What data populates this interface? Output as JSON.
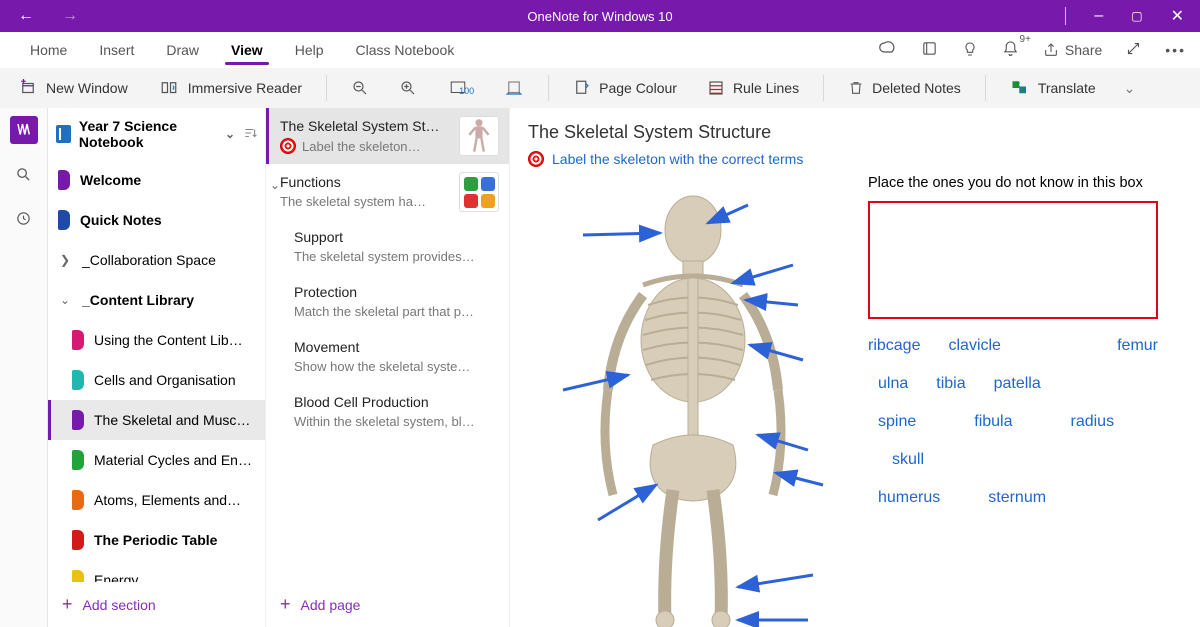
{
  "titlebar": {
    "title": "OneNote for Windows 10"
  },
  "tabs": {
    "items": [
      "Home",
      "Insert",
      "Draw",
      "View",
      "Help",
      "Class Notebook"
    ],
    "active_index": 3,
    "share_label": "Share",
    "notification_badge": "9+"
  },
  "toolbar": {
    "new_window": "New Window",
    "immersive_reader": "Immersive Reader",
    "page_colour": "Page Colour",
    "rule_lines": "Rule Lines",
    "deleted_notes": "Deleted Notes",
    "translate": "Translate"
  },
  "notebook": {
    "name": "Year 7 Science Notebook",
    "add_section": "Add section",
    "sections": [
      {
        "label": "Welcome",
        "color": "#7719AA",
        "type": "section"
      },
      {
        "label": "Quick Notes",
        "color": "#1f4aa8",
        "type": "section"
      },
      {
        "label": "_Collaboration Space",
        "type": "group",
        "expanded": false
      },
      {
        "label": "_Content Library",
        "type": "group",
        "expanded": true
      },
      {
        "label": "Using the Content Lib…",
        "color": "#d61a72",
        "type": "section",
        "parent": "cl"
      },
      {
        "label": "Cells and Organisation",
        "color": "#1fb7b0",
        "type": "section",
        "parent": "cl"
      },
      {
        "label": "The Skeletal and Musc…",
        "color": "#7719AA",
        "type": "section",
        "parent": "cl",
        "selected": true
      },
      {
        "label": "Material Cycles and En…",
        "color": "#1fa33a",
        "type": "section",
        "parent": "cl"
      },
      {
        "label": "Atoms, Elements and…",
        "color": "#e86a12",
        "type": "section",
        "parent": "cl"
      },
      {
        "label": "The Periodic Table",
        "color": "#d11a1a",
        "type": "section",
        "parent": "cl"
      },
      {
        "label": "Energy",
        "color": "#e8c212",
        "type": "section",
        "parent": "cl"
      }
    ]
  },
  "pages": {
    "add_page": "Add page",
    "items": [
      {
        "title": "The Skeletal System St…",
        "sub": "Label the skeleton…",
        "selected": true,
        "target_icon": true,
        "thumb": "skeleton"
      },
      {
        "title": "Functions",
        "sub": "The skeletal system ha…",
        "expandable": true,
        "thumb": "grid"
      },
      {
        "title": "Support",
        "sub": "The skeletal system provides…",
        "child": true
      },
      {
        "title": "Protection",
        "sub": "Match the skeletal part that p…",
        "child": true
      },
      {
        "title": "Movement",
        "sub": "Show how the skeletal syste…",
        "child": true
      },
      {
        "title": "Blood Cell Production",
        "sub": "Within the skeletal system, bl…",
        "child": true
      }
    ]
  },
  "canvas": {
    "page_title": "The Skeletal System Structure",
    "instruction": "Label the skeleton with the correct terms",
    "drop_prompt": "Place the ones you do not know in this box",
    "terms": [
      "ribcage",
      "clavicle",
      "femur",
      "ulna",
      "tibia",
      "patella",
      "spine",
      "fibula",
      "radius",
      "skull",
      "humerus",
      "sternum"
    ]
  }
}
